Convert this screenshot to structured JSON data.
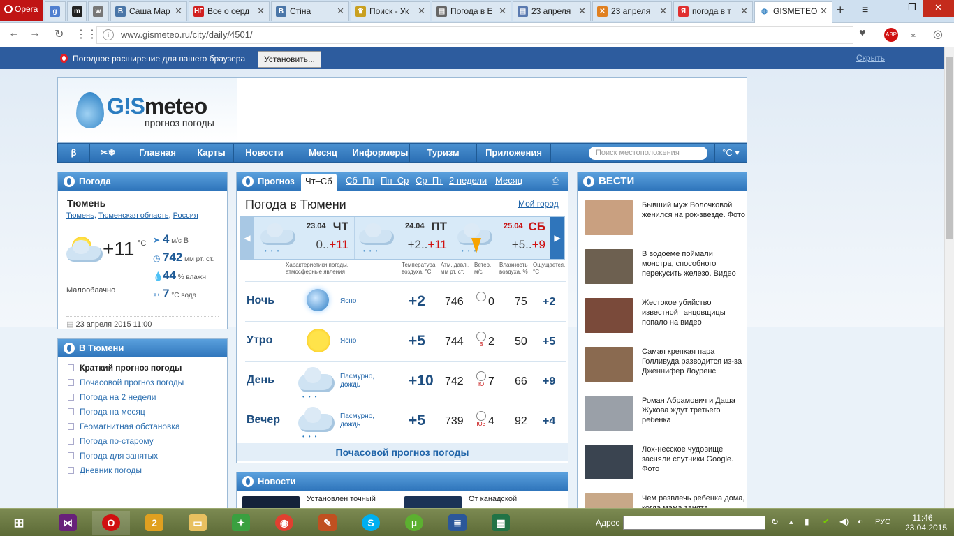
{
  "browser": {
    "opera_label": "Opera",
    "tabs": [
      {
        "label": "",
        "fav": "g",
        "color": "#4f7fd0"
      },
      {
        "label": "",
        "fav": "m",
        "color": "#222"
      },
      {
        "label": "",
        "fav": "w",
        "color": "#777"
      },
      {
        "label": "Саша Мар",
        "fav": "B",
        "color": "#4a76a8"
      },
      {
        "label": "Все о серд",
        "fav": "НГ",
        "color": "#d12020"
      },
      {
        "label": "Стіна",
        "fav": "B",
        "color": "#4a76a8"
      },
      {
        "label": "Поиск - Ук",
        "fav": "♛",
        "color": "#c9a020"
      },
      {
        "label": "Погода в Е",
        "fav": "▤",
        "color": "#666"
      },
      {
        "label": "23 апреля",
        "fav": "▤",
        "color": "#5a7ab0"
      },
      {
        "label": "23 апреля",
        "fav": "✕",
        "color": "#e08020"
      },
      {
        "label": "погода в т",
        "fav": "Я",
        "color": "#e03030"
      },
      {
        "label": "GISMETEO",
        "fav": "◍",
        "color": "#2a7cc0"
      }
    ],
    "url_host": "www.gismeteo.ru",
    "url_path": "/city/daily/4501/"
  },
  "ext_bar": {
    "text": "Погодное расширение для вашего браузера",
    "install": "Установить...",
    "hide": "Скрыть"
  },
  "logo": {
    "brand_gi": "G!S",
    "brand_rest": "meteo",
    "sub": "прогноз погоды"
  },
  "nav": {
    "items": [
      "Главная",
      "Карты",
      "Новости",
      "Месяц",
      "Информеры",
      "Туризм",
      "Приложения"
    ],
    "search_placeholder": "Поиск местоположения",
    "unit": "°C ▾"
  },
  "current": {
    "header": "Погода",
    "city": "Тюмень",
    "links": [
      "Тюмень",
      "Тюменская область",
      "Россия"
    ],
    "temp": "+11",
    "temp_unit": "°C",
    "desc": "Малооблачно",
    "wind_value": "4",
    "wind_unit": "м/с",
    "wind_dir": "В",
    "pressure_value": "742",
    "pressure_unit": "мм рт. ст.",
    "humidity_value": "44",
    "humidity_unit": "% влажн.",
    "water_value": "7",
    "water_unit": "°С вода",
    "date": "23 апреля 2015 11:00"
  },
  "city_menu": {
    "header": "В Тюмени",
    "items": [
      "Краткий прогноз погоды",
      "Почасовой прогноз погоды",
      "Погода на 2 недели",
      "Погода на месяц",
      "Геомагнитная обстановка",
      "Погода по-старому",
      "Погода для занятых",
      "Дневник погоды"
    ]
  },
  "forecast": {
    "header": "Прогноз",
    "tabs": [
      "Чт–Сб",
      "Сб–Пн",
      "Пн–Ср",
      "Ср–Пт",
      "2 недели",
      "Месяц"
    ],
    "title": "Погода в Тюмени",
    "my_city": "Мой город",
    "days": [
      {
        "date": "23.04",
        "name": "ЧТ",
        "min": "0..",
        "max": "+11"
      },
      {
        "date": "24.04",
        "name": "ПТ",
        "min": "+2..",
        "max": "+11"
      },
      {
        "date": "25.04",
        "name": "СБ",
        "min": "+5..",
        "max": "+9"
      }
    ],
    "col_heads": [
      "Характеристики погоды, атмосферные явления",
      "Температура воздуха, °С",
      "Атм. давл., мм рт. ст.",
      "Ветер, м/с",
      "Влажность воздуха, %",
      "Ощущается, °С"
    ],
    "rows": [
      {
        "tod": "Ночь",
        "desc": "Ясно",
        "temp": "+2",
        "pres": "746",
        "wdir": "",
        "ws": "0",
        "hum": "75",
        "feel": "+2"
      },
      {
        "tod": "Утро",
        "desc": "Ясно",
        "temp": "+5",
        "pres": "744",
        "wdir": "В",
        "ws": "2",
        "hum": "50",
        "feel": "+5"
      },
      {
        "tod": "День",
        "desc": "Пасмурно, дождь",
        "temp": "+10",
        "pres": "742",
        "wdir": "Ю",
        "ws": "7",
        "hum": "66",
        "feel": "+9"
      },
      {
        "tod": "Вечер",
        "desc": "Пасмурно, дождь",
        "temp": "+5",
        "pres": "739",
        "wdir": "ЮЗ",
        "ws": "4",
        "hum": "92",
        "feel": "+4"
      }
    ],
    "hourly": "Почасовой прогноз погоды"
  },
  "news_panel": {
    "header": "Новости",
    "items": [
      "Установлен точный",
      "От канадской"
    ]
  },
  "vesti": {
    "header": "ВЕСТИ",
    "items": [
      "Бывший муж Волочковой женился на рок-звезде. Фото",
      "В водоеме поймали монстра, способного перекусить железо. Видео",
      "Жестокое убийство известной танцовщицы попало на видео",
      "Самая крепкая пара Голливуда разводится из-за Дженнифер Лоуренс",
      "Роман Абрамович и Даша Жукова ждут третьего ребенка",
      "Лох-несское чудовище засняли спутники Google. Фото",
      "Чем развлечь ребенка дома, когда мама занята"
    ]
  },
  "taskbar": {
    "addr_label": "Адрес",
    "lang": "РУС",
    "time": "11:46",
    "date": "23.04.2015"
  }
}
